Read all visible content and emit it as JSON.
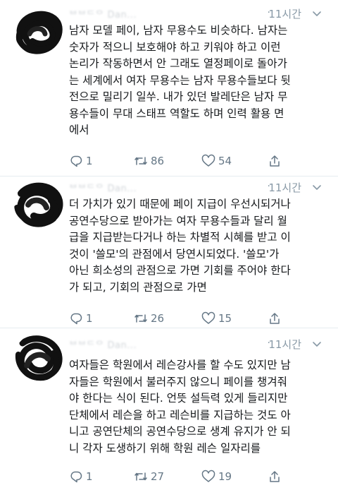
{
  "tweets": [
    {
      "author": "ᄇᄇᄃᄋ Dan...",
      "time": "11시간",
      "text": "남자 모델 페이, 남자 무용수도 비슷하다. 남자는\n숫자가 적으니 보호해야 하고 키워야 하고 이런\n논리가 작동하면서 안 그래도 열정페이로 돌아가\n는 세계에서 여자 무용수는 남자 무용수들보다 뒷\n전으로 밀리기 일쑤. 내가 있던 발레단은 남자 무\n용수들이 무대 스태프 역할도 하며 인력 활용 면\n에서",
      "replies": "1",
      "retweets": "86",
      "likes": "54"
    },
    {
      "author": "ᄇᄇᄃᄋ Dan...",
      "time": "11시간",
      "text": "더 가치가 있기 때문에 페이 지급이 우선시되거나\n공연수당으로 받아가는 여자 무용수들과 달리 월\n급을 지급받는다거나 하는 차별적 시혜를 받고 이\n것이 '쓸모'의 관점에서 당연시되었다. '쓸모'가\n아닌 희소성의 관점으로 가면 기회를 주어야 한다\n가 되고, 기회의 관점으로 가면",
      "replies": "1",
      "retweets": "26",
      "likes": "15"
    },
    {
      "author": "ᄇᄇᄃᄋ Dan...",
      "time": "11시간",
      "text": "여자들은 학원에서 레슨강사를 할 수도 있지만 남\n자들은 학원에서 불러주지 않으니 페이를 챙겨줘\n야 한다는 식이 된다. 언뜻 설득력 있게 들리지만\n단체에서 레슨을 하고 레슨비를 지급하는 것도 아\n니고 공연단체의 공연수당으로 생계 유지가 안 되\n니 각자 도생하기 위해 학원 레슨 일자리를",
      "replies": "1",
      "retweets": "27",
      "likes": "19"
    }
  ],
  "icons": {
    "reply": "reply-icon",
    "retweet": "retweet-icon",
    "like": "heart-icon",
    "share": "share-icon",
    "caret": "chevron-down-icon"
  },
  "colors": {
    "text": "#14171a",
    "meta": "#8899a6",
    "action": "#657786",
    "divider": "#e6ecf0"
  }
}
